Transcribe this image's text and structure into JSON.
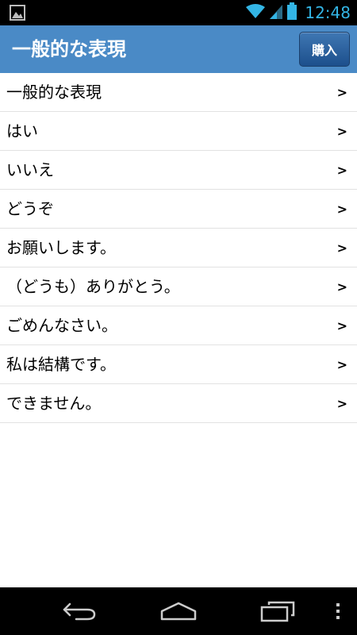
{
  "status_bar": {
    "time": "12:48",
    "icons": [
      "gallery-icon",
      "wifi-icon",
      "signal-icon",
      "battery-icon"
    ]
  },
  "action_bar": {
    "title": "一般的な表現",
    "buy_label": "購入"
  },
  "list": {
    "chevron": ">",
    "items": [
      {
        "label": "一般的な表現"
      },
      {
        "label": "はい"
      },
      {
        "label": "いいえ"
      },
      {
        "label": "どうぞ"
      },
      {
        "label": "お願いします。"
      },
      {
        "label": "（どうも）ありがとう。"
      },
      {
        "label": "ごめんなさい。"
      },
      {
        "label": "私は結構です。"
      },
      {
        "label": "できません。"
      }
    ]
  },
  "nav_bar": {
    "icons": [
      "back-icon",
      "home-icon",
      "recent-apps-icon",
      "menu-icon"
    ]
  },
  "colors": {
    "action_bar": "#4a8ac6",
    "status_accent": "#33b5e5",
    "buy_button": "#1c4f8c"
  }
}
